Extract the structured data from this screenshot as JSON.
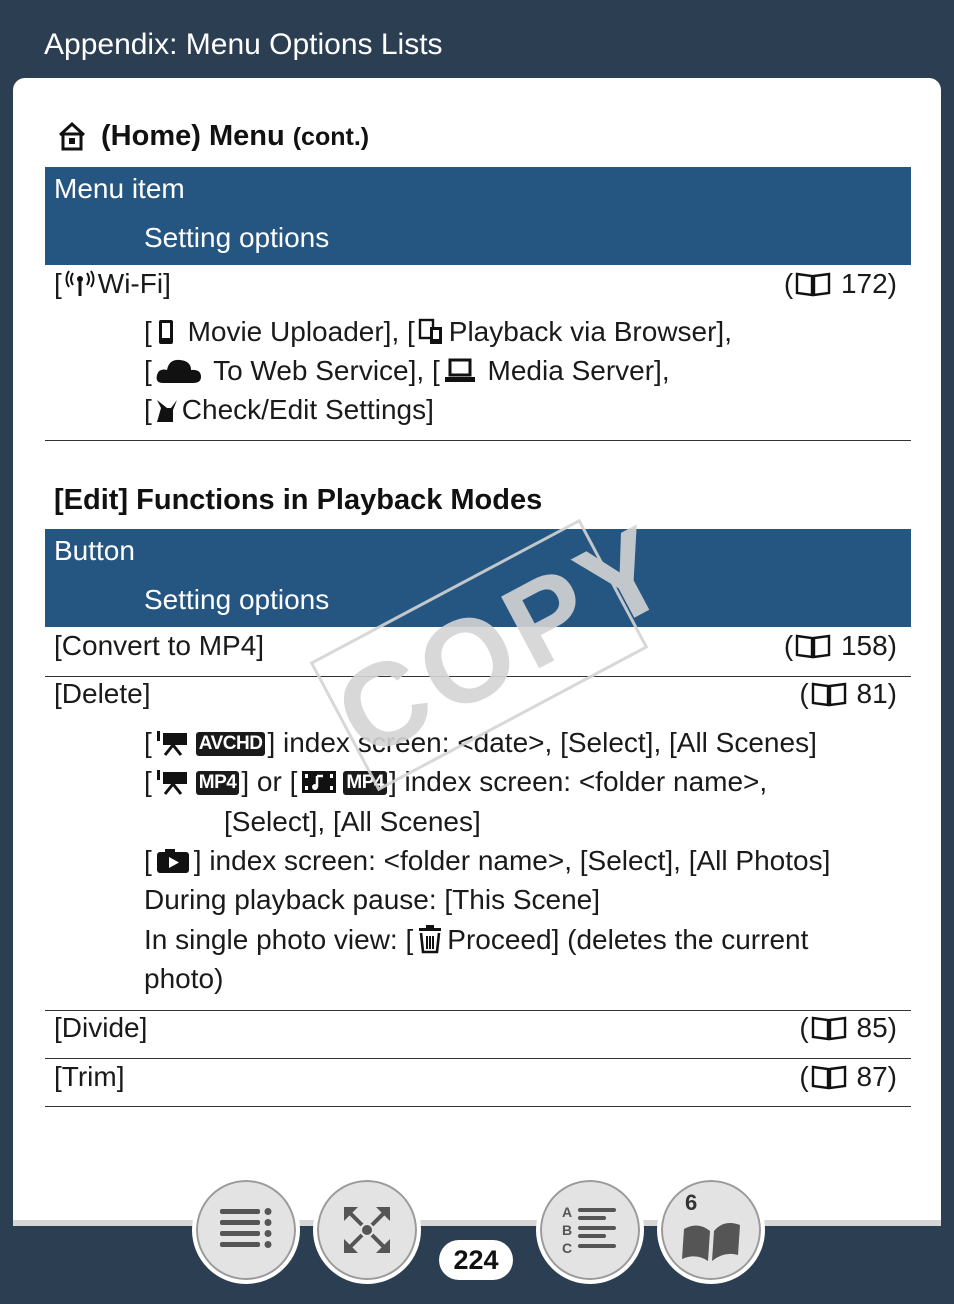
{
  "header": {
    "title": "Appendix: Menu Options Lists"
  },
  "home_section": {
    "title": "(Home) Menu",
    "title_suffix": "(cont.)",
    "col1": "Menu item",
    "col2": "Setting options",
    "wifi": {
      "label_open": "[",
      "label": "Wi-Fi]",
      "ref": "172)",
      "ref_open": "(",
      "line1_a": "Movie Uploader], [",
      "line1_b": "Playback via Browser],",
      "line2_a": "To Web Service], [",
      "line2_b": "Media Server],",
      "line3": "Check/Edit Settings]",
      "bracket": "["
    }
  },
  "edit_section": {
    "title": "[Edit] Functions in Playback Modes",
    "col1": "Button",
    "col2": "Setting options",
    "rows": [
      {
        "label": "[Convert to MP4]",
        "ref": "158)"
      },
      {
        "label": "[Delete]",
        "ref": "81)"
      },
      {
        "label": "[Divide]",
        "ref": "85)"
      },
      {
        "label": "[Trim]",
        "ref": "87)"
      }
    ],
    "delete": {
      "l1": "] index screen: <date>, [Select], [All Scenes]",
      "l2a": "] or [",
      "l2b": "] index screen: <folder name>,",
      "l3": "[Select], [All Scenes]",
      "l4": "] index screen: <folder name>, [Select], [All Photos]",
      "l5": "During playback pause: [This Scene]",
      "l6a": "In single photo view: [",
      "l6b": "Proceed] (deletes the current",
      "l7": "photo)",
      "badge_avchd": "AVCHD",
      "badge_mp4": "MP4",
      "bracket": "["
    }
  },
  "watermark": "COPY",
  "nav": {
    "page_number": "224",
    "chapter_number": "6",
    "buttons": [
      "contents-icon",
      "fullscreen-icon",
      "index-icon",
      "chapter-book-icon"
    ]
  }
}
